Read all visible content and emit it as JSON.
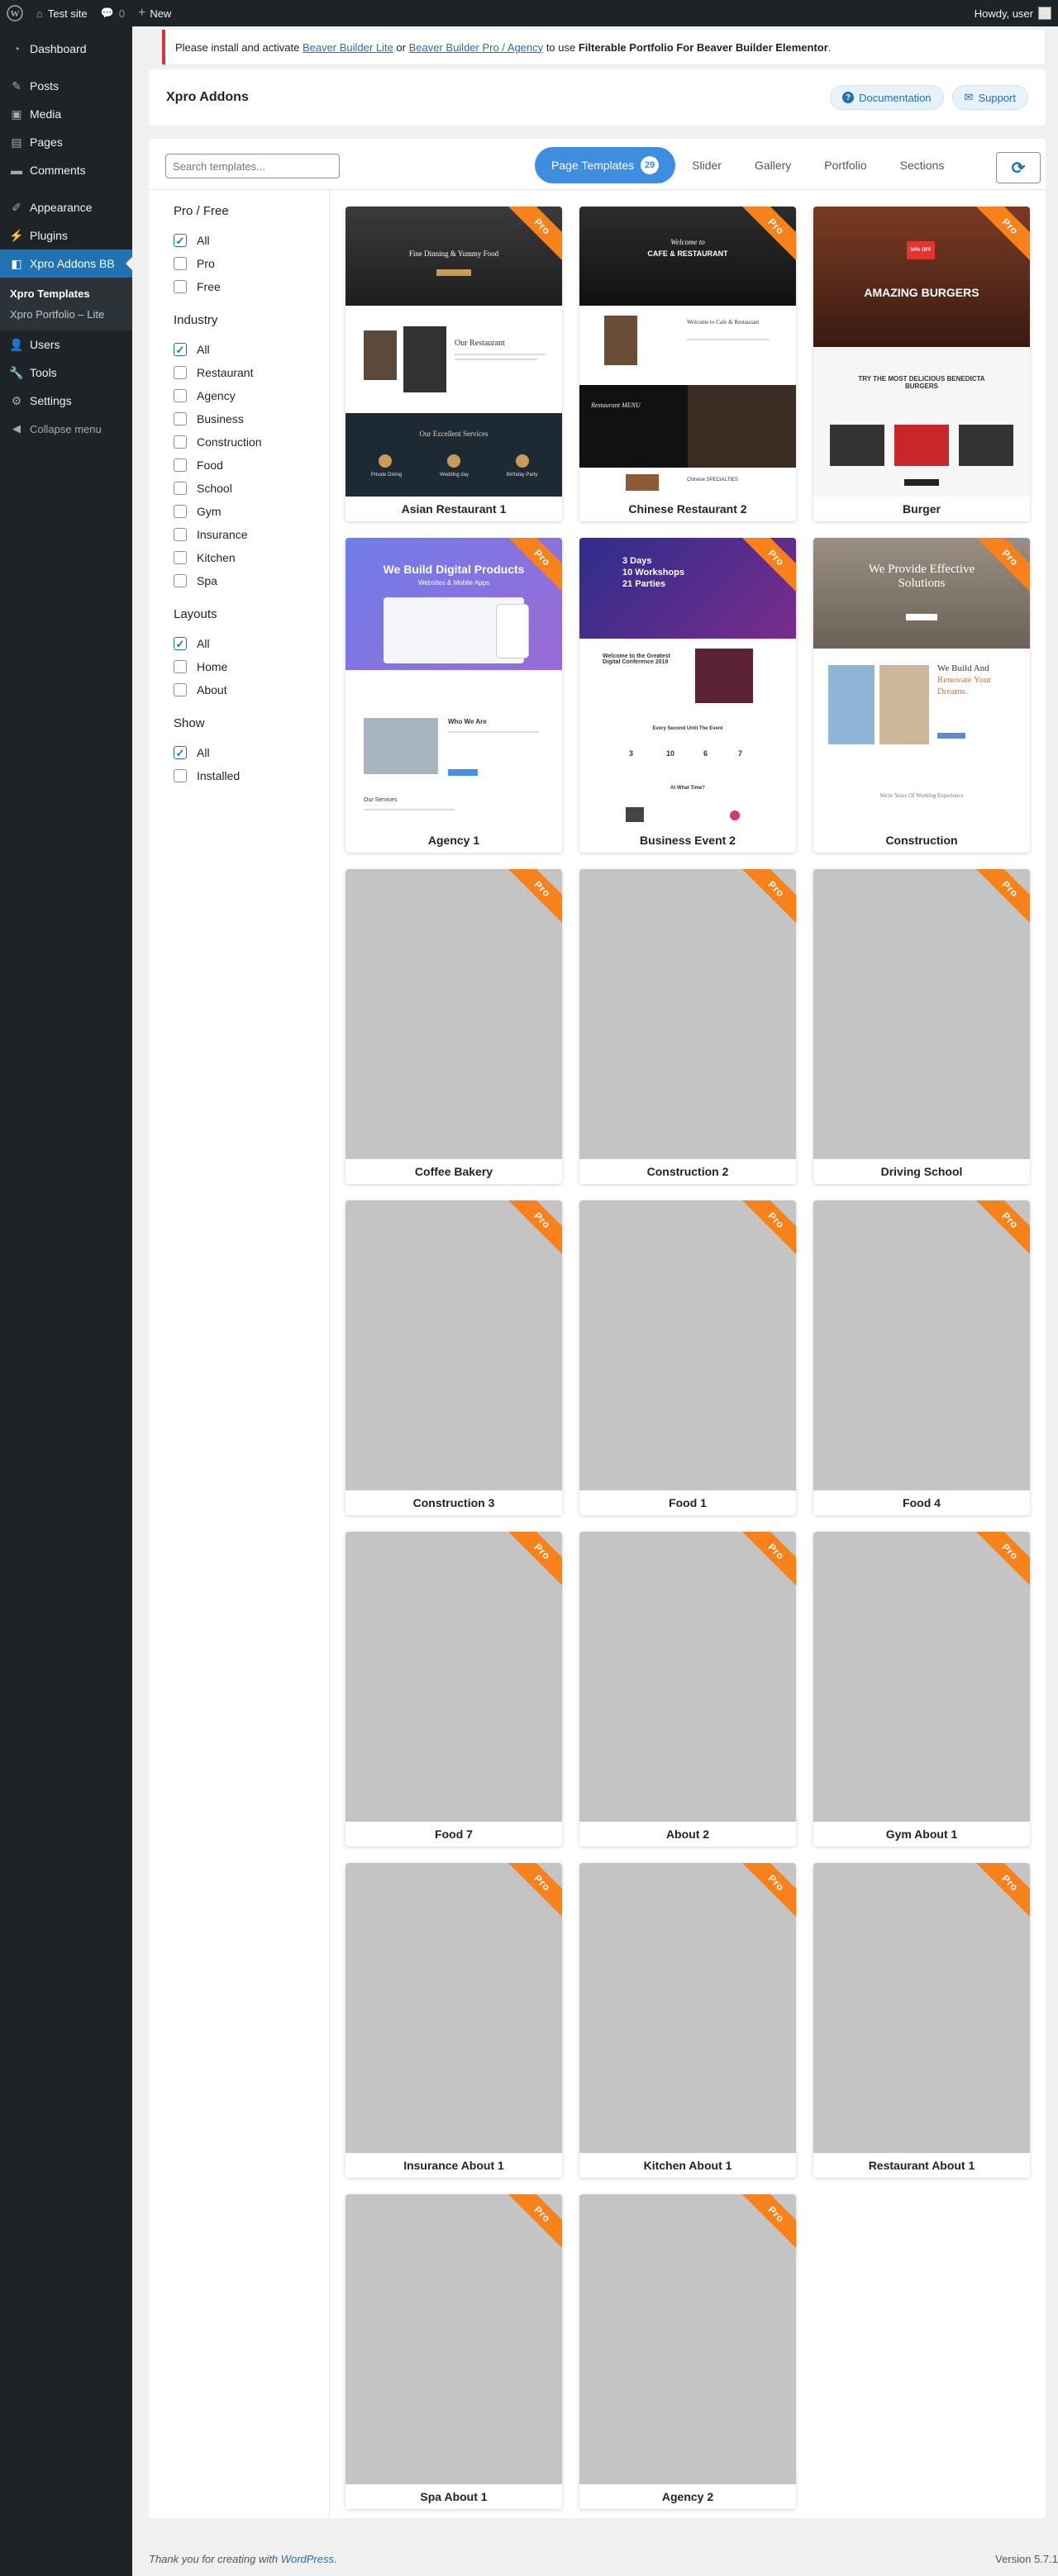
{
  "adminbar": {
    "site_name": "Test site",
    "comments_count": "0",
    "new_label": "New",
    "howdy": "Howdy, user"
  },
  "sidebar": {
    "items": [
      {
        "label": "Dashboard",
        "icon": "dashboard-icon"
      },
      {
        "label": "Posts",
        "icon": "pin-icon"
      },
      {
        "label": "Media",
        "icon": "media-icon"
      },
      {
        "label": "Pages",
        "icon": "pages-icon"
      },
      {
        "label": "Comments",
        "icon": "comment-icon"
      },
      {
        "label": "Appearance",
        "icon": "brush-icon"
      },
      {
        "label": "Plugins",
        "icon": "plug-icon"
      },
      {
        "label": "Xpro Addons BB",
        "icon": "xpro-icon"
      },
      {
        "label": "Users",
        "icon": "users-icon"
      },
      {
        "label": "Tools",
        "icon": "wrench-icon"
      },
      {
        "label": "Settings",
        "icon": "settings-icon"
      }
    ],
    "submenu": [
      "Xpro Templates",
      "Xpro Portfolio – Lite"
    ],
    "collapse": "Collapse menu"
  },
  "notice": {
    "pre": "Please install and activate ",
    "link1": "Beaver Builder Lite",
    "mid": " or ",
    "link2": "Beaver Builder Pro / Agency",
    "post": " to use ",
    "bold": "Filterable Portfolio For Beaver Builder Elementor",
    "end": "."
  },
  "header": {
    "title": "Xpro Addons",
    "documentation": "Documentation",
    "support": "Support"
  },
  "toolbar": {
    "search_placeholder": "Search templates...",
    "tabs": [
      "Page Templates",
      "Slider",
      "Gallery",
      "Portfolio",
      "Sections"
    ],
    "count": "29"
  },
  "filters": {
    "pro_free": {
      "title": "Pro / Free",
      "options": [
        "All",
        "Pro",
        "Free"
      ]
    },
    "industry": {
      "title": "Industry",
      "options": [
        "All",
        "Restaurant",
        "Agency",
        "Business",
        "Construction",
        "Food",
        "School",
        "Gym",
        "Insurance",
        "Kitchen",
        "Spa"
      ]
    },
    "layouts": {
      "title": "Layouts",
      "options": [
        "All",
        "Home",
        "About"
      ]
    },
    "show": {
      "title": "Show",
      "options": [
        "All",
        "Installed"
      ]
    }
  },
  "pro_label": "Pro",
  "templates": [
    "Asian Restaurant 1",
    "Chinese Restaurant 2",
    "Burger",
    "Agency 1",
    "Business Event 2",
    "Construction",
    "Coffee Bakery",
    "Construction 2",
    "Driving School",
    "Construction 3",
    "Food 1",
    "Food 4",
    "Food 7",
    "About 2",
    "Gym About 1",
    "Insurance About 1",
    "Kitchen About 1",
    "Restaurant About 1",
    "Spa About 1",
    "Agency 2"
  ],
  "thumb_text": {
    "asian_hero": "Fine Dinning & Yummy Food",
    "asian_mid": "Our Restaurant",
    "asian_services": "Our Excellent Services",
    "asian_svc1": "Private Dining",
    "asian_svc2": "Wedding day",
    "asian_svc3": "Birthday Party",
    "chinese_hero1": "Welcome to",
    "chinese_hero2": "CAFE & RESTAURANT",
    "chinese_mid": "Welcome to Cafe & Restaurant",
    "chinese_menu": "Restaurant MENU",
    "chinese_specialties": "Chinese SPECIALTIES",
    "burger_promo": "30% OFF",
    "burger_hero": "AMAZING BURGERS",
    "burger_sub": "TRY THE MOST DELICIOUS BENEDICTA BURGERS",
    "agency_hero": "We Build Digital Products",
    "agency_sub": "Websites & Mobile Apps",
    "agency_who": "Who We Are",
    "agency_services": "Our Services",
    "event_hero1": "3 Days",
    "event_hero2": "10 Workshops",
    "event_hero3": "21 Parties",
    "event_welcome": "Welcome to the Greatest Digital Conference 2019",
    "event_every": "Every Second Until The Event",
    "event_count": [
      "3",
      "10",
      "6",
      "7"
    ],
    "event_what": "At What Time?",
    "construction_hero": "We Provide Effective Solutions",
    "construction_mid1": "We Build And",
    "construction_mid2": "Renovate Your",
    "construction_mid3": "Dreams.",
    "construction_years": "We're Years Of Working Experience"
  },
  "footer": {
    "thanks": "Thank you for creating with ",
    "wp": "WordPress",
    "end": ".",
    "version": "Version 5.7.1"
  },
  "colors": {
    "accent": "#2271b1",
    "tab_active": "#3d8ee0",
    "ribbon": "#f7821b",
    "sidebar": "#1d2327"
  }
}
